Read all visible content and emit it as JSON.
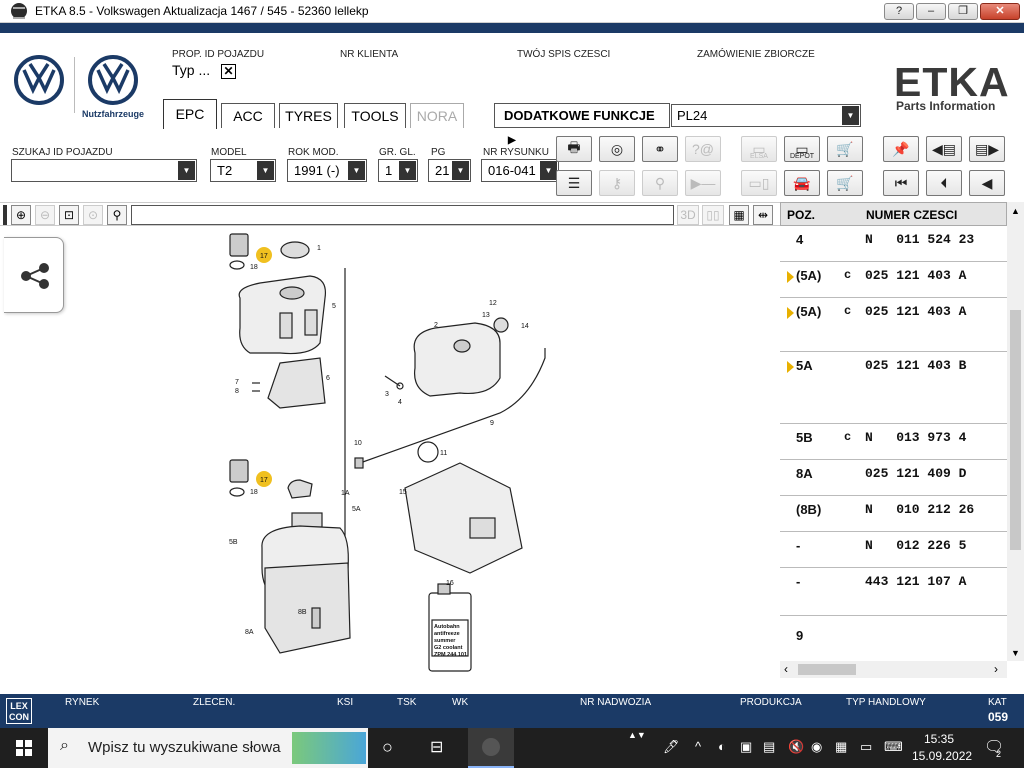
{
  "window": {
    "title": "ETKA 8.5 - Volkswagen Aktualizacja 1467 / 545 - 52360 lellekp",
    "help": "?",
    "minimize": "–",
    "maximize": "❐",
    "close": "✕"
  },
  "brand": {
    "nutzfahrzeuge": "Nutzfahrzeuge",
    "etka": "ETKA",
    "etka_sub": "Parts Information"
  },
  "header": {
    "prop_id": "PROP. ID POJAZDU",
    "nr_klienta": "NR KLIENTA",
    "twoj_spis": "TWÓJ SPIS CZESCI",
    "zamowienie": "ZAMÓWIENIE ZBIORCZE",
    "typ": "Typ ...",
    "typ_close": "✕"
  },
  "tabs": [
    {
      "label": "EPC",
      "active": true
    },
    {
      "label": "ACC"
    },
    {
      "label": "TYRES"
    },
    {
      "label": "TOOLS"
    },
    {
      "label": "NORA",
      "disabled": true
    }
  ],
  "extra": {
    "label": "DODATKOWE FUNKCJE",
    "arrow": "▶",
    "selected": "PL24"
  },
  "filters": {
    "szukaj": {
      "label": "SZUKAJ ID POJAZDU",
      "value": ""
    },
    "model": {
      "label": "MODEL",
      "value": "T2"
    },
    "rok": {
      "label": "ROK MOD.",
      "value": "1991 (-)"
    },
    "gr": {
      "label": "GR. GL.",
      "value": "1"
    },
    "pg": {
      "label": "PG",
      "value": "21"
    },
    "rys": {
      "label": "NR RYSUNKU",
      "value": "016-041"
    }
  },
  "toolbar_labels": {
    "elsa": "ELSA",
    "depot": "DEPOT",
    "three_d": "3D"
  },
  "parts": {
    "col_pos": "POZ.",
    "col_num": "NUMER CZESCI",
    "rows": [
      {
        "pos": "4",
        "flag": "",
        "num": "N   011 524 23",
        "marker": false
      },
      {
        "pos": "(5A)",
        "flag": "c",
        "num": "025 121 403 A",
        "marker": true
      },
      {
        "pos": "(5A)",
        "flag": "c",
        "num": "025 121 403 A",
        "marker": true
      },
      {
        "pos": "5A",
        "flag": "",
        "num": "025 121 403 B",
        "marker": true
      },
      {
        "pos": "5B",
        "flag": "c",
        "num": "N   013 973 4",
        "marker": false
      },
      {
        "pos": "8A",
        "flag": "",
        "num": "025 121 409 D",
        "marker": false
      },
      {
        "pos": "(8B)",
        "flag": "",
        "num": "N   010 212 26",
        "marker": false
      },
      {
        "pos": "-",
        "flag": "",
        "num": "N   012 226 5",
        "marker": false
      },
      {
        "pos": "-",
        "flag": "",
        "num": "443 121 107 A",
        "marker": false
      },
      {
        "pos": "9",
        "flag": "",
        "num": "",
        "marker": false
      }
    ]
  },
  "illustration": {
    "callouts": [
      "1",
      "17",
      "18",
      "5",
      "6",
      "7",
      "8",
      "2",
      "3",
      "4",
      "12",
      "13",
      "14",
      "9",
      "10",
      "11",
      "1A",
      "5A",
      "5B",
      "8B",
      "8A",
      "15",
      "16",
      "17",
      "18"
    ],
    "bottle_text": [
      "Autobahn",
      "antifreeze",
      "summer",
      "G2 coolant",
      "ZPM 244 101"
    ]
  },
  "status": {
    "lexcon": "LEX CON",
    "rynek": "RYNEK",
    "zlecen": "ZLECEN.",
    "ksi": "KSI",
    "tsk": "TSK",
    "wk": "WK",
    "nr_nadwozia": "NR NADWOZIA",
    "produkcja": "PRODUKCJA",
    "typ_handlowy": "TYP HANDLOWY",
    "kat": "KAT",
    "kat_value": "059"
  },
  "taskbar": {
    "search_placeholder": "Wpisz tu wyszukiwane słowa",
    "time": "15:35",
    "date": "15.09.2022",
    "notifications": "2"
  }
}
